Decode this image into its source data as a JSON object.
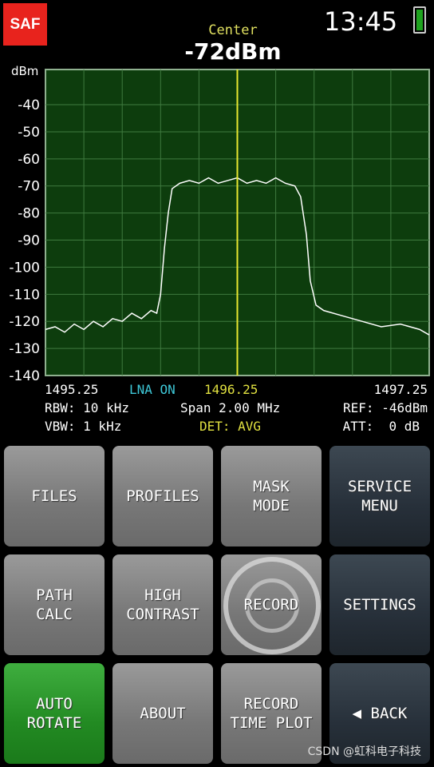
{
  "header": {
    "logo": "SAF",
    "center_label": "Center",
    "center_value": "-72dBm",
    "time": "13:45",
    "battery_level": 1.0
  },
  "chart_data": {
    "type": "line",
    "ylabel": "dBm",
    "ylim": [
      -140,
      -27
    ],
    "yticks": [
      -40,
      -50,
      -60,
      -70,
      -80,
      -90,
      -100,
      -110,
      -120,
      -130,
      -140
    ],
    "xlim": [
      1495.25,
      1497.25
    ],
    "grid": true,
    "marker_x": 1496.25,
    "colors": {
      "background": "#0d3d0d",
      "grid": "#3f7a3f",
      "trace": "#ffffff",
      "marker": "#e8e830"
    },
    "trace": [
      [
        1495.25,
        -123
      ],
      [
        1495.3,
        -122
      ],
      [
        1495.35,
        -124
      ],
      [
        1495.4,
        -121
      ],
      [
        1495.45,
        -123
      ],
      [
        1495.5,
        -120
      ],
      [
        1495.55,
        -122
      ],
      [
        1495.6,
        -119
      ],
      [
        1495.65,
        -120
      ],
      [
        1495.7,
        -117
      ],
      [
        1495.75,
        -119
      ],
      [
        1495.8,
        -116
      ],
      [
        1495.83,
        -117
      ],
      [
        1495.85,
        -110
      ],
      [
        1495.87,
        -93
      ],
      [
        1495.89,
        -80
      ],
      [
        1495.91,
        -71
      ],
      [
        1495.95,
        -69
      ],
      [
        1496.0,
        -68
      ],
      [
        1496.05,
        -69
      ],
      [
        1496.1,
        -67
      ],
      [
        1496.15,
        -69
      ],
      [
        1496.2,
        -68
      ],
      [
        1496.25,
        -67
      ],
      [
        1496.3,
        -69
      ],
      [
        1496.35,
        -68
      ],
      [
        1496.4,
        -69
      ],
      [
        1496.45,
        -67
      ],
      [
        1496.5,
        -69
      ],
      [
        1496.55,
        -70
      ],
      [
        1496.58,
        -74
      ],
      [
        1496.61,
        -88
      ],
      [
        1496.63,
        -105
      ],
      [
        1496.66,
        -114
      ],
      [
        1496.7,
        -116
      ],
      [
        1496.8,
        -118
      ],
      [
        1496.9,
        -120
      ],
      [
        1497.0,
        -122
      ],
      [
        1497.1,
        -121
      ],
      [
        1497.2,
        -123
      ],
      [
        1497.25,
        -125
      ]
    ]
  },
  "info": {
    "start": "1495.25",
    "lna": "LNA ON",
    "center": "1496.25",
    "stop": "1497.25",
    "rbw": "RBW: 10 kHz",
    "span": "Span 2.00 MHz",
    "ref": "REF: -46dBm",
    "vbw": "VBW: 1 kHz",
    "det": "DET: AVG",
    "att": "ATT:  0 dB"
  },
  "buttons": [
    "FILES",
    "PROFILES",
    "MASK\nMODE",
    "SERVICE\nMENU",
    "PATH\nCALC",
    "HIGH\nCONTRAST",
    "RECORD",
    "SETTINGS",
    "AUTO\nROTATE",
    "ABOUT",
    "RECORD\nTIME PLOT",
    "◀ BACK"
  ],
  "watermark": "CSDN @虹科电子科技"
}
